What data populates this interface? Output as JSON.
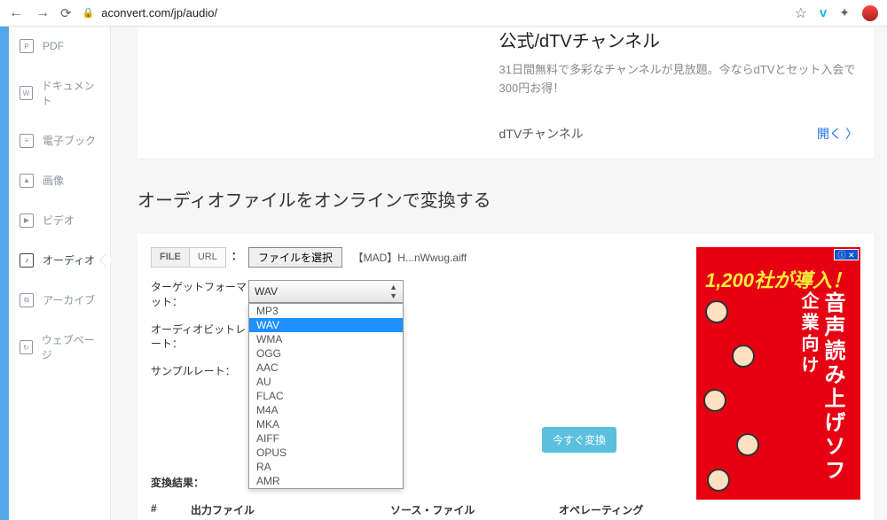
{
  "browser": {
    "url": "aconvert.com/jp/audio/"
  },
  "sidebar": {
    "items": [
      {
        "label": "PDF"
      },
      {
        "label": "ドキュメント"
      },
      {
        "label": "電子ブック"
      },
      {
        "label": "画像"
      },
      {
        "label": "ビデオ"
      },
      {
        "label": "オーディオ"
      },
      {
        "label": "アーカイブ"
      },
      {
        "label": "ウェブページ"
      }
    ]
  },
  "top_ad": {
    "title": "公式/dTVチャンネル",
    "desc": "31日間無料で多彩なチャンネルが見放題。今ならdTVとセット入会で300円お得！",
    "link_label": "dTVチャンネル",
    "open_label": "開く"
  },
  "heading": "オーディオファイルをオンラインで変換する",
  "form": {
    "tab_file": "FILE",
    "tab_url": "URL",
    "tab_sep": "：",
    "file_btn": "ファイルを選択",
    "file_name": "【MAD】H...nWwug.aiff",
    "label_target": "ターゲットフォーマット：",
    "label_bitrate": "オーディオビットレート：",
    "label_sample": "サンプルレート：",
    "select_value": "WAV",
    "options": [
      "MP3",
      "WAV",
      "WMA",
      "OGG",
      "AAC",
      "AU",
      "FLAC",
      "M4A",
      "MKA",
      "AIFF",
      "OPUS",
      "RA",
      "AMR"
    ],
    "convert_btn": "今すぐ変換"
  },
  "results": {
    "label": "変換結果：",
    "cols": [
      "#",
      "出力ファイル",
      "ソース・ファイル",
      "オペレーティング"
    ]
  },
  "right_ad": {
    "headline": "1,200社が導入！",
    "vert1": "音声読み上げソフ",
    "vert2": "企業向け"
  }
}
